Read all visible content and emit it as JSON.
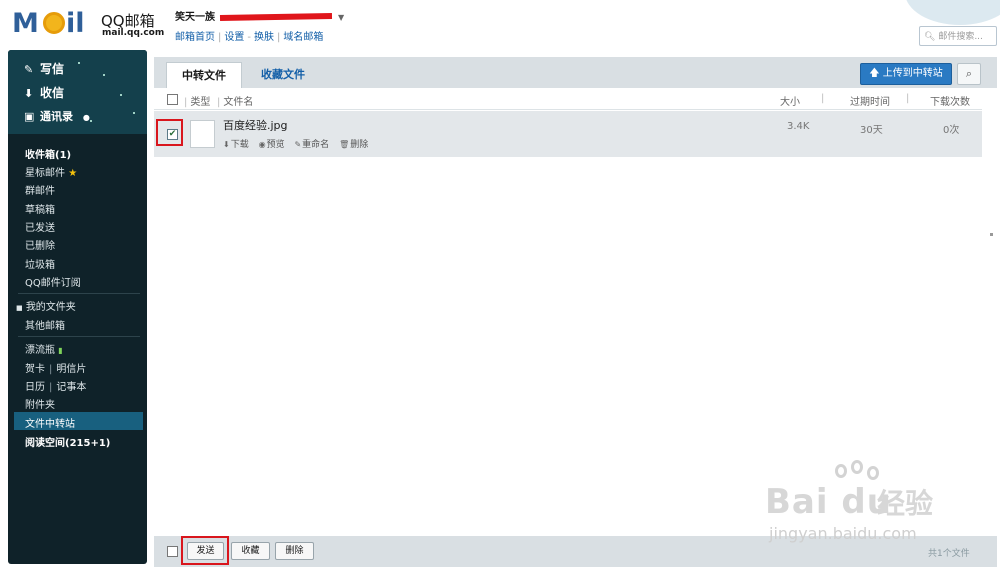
{
  "header": {
    "logo_brand": "QQ邮箱",
    "logo_domain": "mail.qq.com",
    "logo_mark_m": "M",
    "logo_mark_il": "il",
    "user_name": "笑天一族",
    "links": [
      "邮箱首页",
      "设置",
      "换肤",
      "域名邮箱"
    ],
    "search_placeholder": "邮件搜索..."
  },
  "sidebar": {
    "actions": [
      {
        "label": "写信",
        "icon": "pen-icon"
      },
      {
        "label": "收信",
        "icon": "download-icon"
      },
      {
        "label": "通讯录",
        "icon": "contacts-icon"
      }
    ],
    "inbox": "收件箱(1)",
    "starred": "星标邮件",
    "items_a": [
      "群邮件",
      "草稿箱",
      "已发送",
      "已删除",
      "垃圾箱",
      "QQ邮件订阅"
    ],
    "my_folders": "我的文件夹",
    "other_mailbox": "其他邮箱",
    "drift_bottle": "漂流瓶",
    "greeting_card": "贺卡",
    "postcard": "明信片",
    "calendar": "日历",
    "notes": "记事本",
    "attachments": "附件夹",
    "transfer_station": "文件中转站",
    "reading_space": "阅读空间(215+1)"
  },
  "main": {
    "tabs": [
      {
        "label": "中转文件",
        "active": true
      },
      {
        "label": "收藏文件",
        "active": false
      }
    ],
    "upload_label": "上传到中转站",
    "columns": {
      "type": "类型",
      "name": "文件名",
      "size": "大小",
      "expire": "过期时间",
      "downloads": "下载次数"
    },
    "file": {
      "name": "百度经验.jpg",
      "size": "3.4K",
      "expire": "30天",
      "downloads": "0次",
      "checked": true,
      "actions": [
        "下载",
        "预览",
        "重命名",
        "删除"
      ]
    },
    "footer": {
      "send": "发送",
      "collect": "收藏",
      "delete": "删除",
      "count": "共1个文件"
    }
  },
  "watermark": {
    "brand": "Bai du",
    "cn": "经验",
    "url": "jingyan.baidu.com"
  },
  "colors": {
    "accent": "#2a7ac3",
    "sidebar_bg": "#0f2229",
    "active_nav": "#18607f",
    "highlight_red": "#d9161d"
  }
}
